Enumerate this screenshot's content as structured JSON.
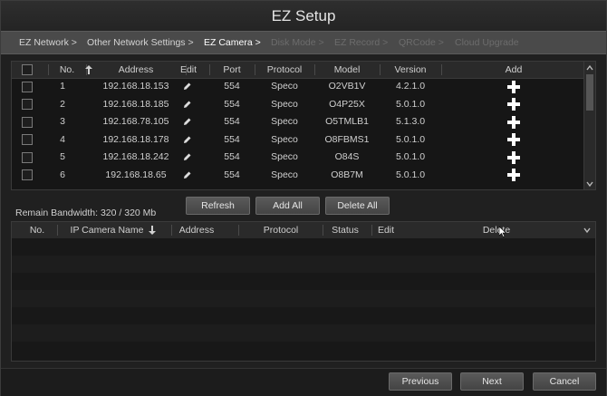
{
  "window": {
    "title": "EZ Setup"
  },
  "steps": [
    {
      "label": "EZ Network >",
      "state": "done"
    },
    {
      "label": "Other Network Settings >",
      "state": "done"
    },
    {
      "label": "EZ Camera >",
      "state": "active"
    },
    {
      "label": "Disk Mode >",
      "state": "disabled"
    },
    {
      "label": "EZ Record >",
      "state": "disabled"
    },
    {
      "label": "QRCode >",
      "state": "disabled"
    },
    {
      "label": "Cloud Upgrade",
      "state": "disabled"
    }
  ],
  "search_table": {
    "columns": {
      "no": "No.",
      "address": "Address",
      "edit": "Edit",
      "port": "Port",
      "protocol": "Protocol",
      "model": "Model",
      "version": "Version",
      "add": "Add"
    },
    "sort_icon": "arrow-up-icon",
    "rows": [
      {
        "no": "1",
        "address": "192.168.18.153",
        "port": "554",
        "protocol": "Speco",
        "model": "O2VB1V",
        "version": "4.2.1.0"
      },
      {
        "no": "2",
        "address": "192.168.18.185",
        "port": "554",
        "protocol": "Speco",
        "model": "O4P25X",
        "version": "5.0.1.0"
      },
      {
        "no": "3",
        "address": "192.168.78.105",
        "port": "554",
        "protocol": "Speco",
        "model": "O5TMLB1",
        "version": "5.1.3.0"
      },
      {
        "no": "4",
        "address": "192.168.18.178",
        "port": "554",
        "protocol": "Speco",
        "model": "O8FBMS1",
        "version": "5.0.1.0"
      },
      {
        "no": "5",
        "address": "192.168.18.242",
        "port": "554",
        "protocol": "Speco",
        "model": "O84S",
        "version": "5.0.1.0"
      },
      {
        "no": "6",
        "address": "192.168.18.65",
        "port": "554",
        "protocol": "Speco",
        "model": "O8B7M",
        "version": "5.0.1.0"
      }
    ]
  },
  "actions": {
    "refresh": "Refresh",
    "add_all": "Add All",
    "delete_all": "Delete All"
  },
  "bandwidth": {
    "label": "Remain Bandwidth: 320 / 320 Mb"
  },
  "added_table": {
    "columns": {
      "no": "No.",
      "name": "IP Camera Name",
      "address": "Address",
      "protocol": "Protocol",
      "status": "Status",
      "edit": "Edit",
      "delete": "Delete"
    },
    "sort_icon": "arrow-down-icon",
    "rows": []
  },
  "footer": {
    "previous": "Previous",
    "next": "Next",
    "cancel": "Cancel"
  },
  "colors": {
    "background": "#202020",
    "header": "#2a2a2a",
    "step_bar": "#4a4a4a",
    "button": "#505050"
  }
}
